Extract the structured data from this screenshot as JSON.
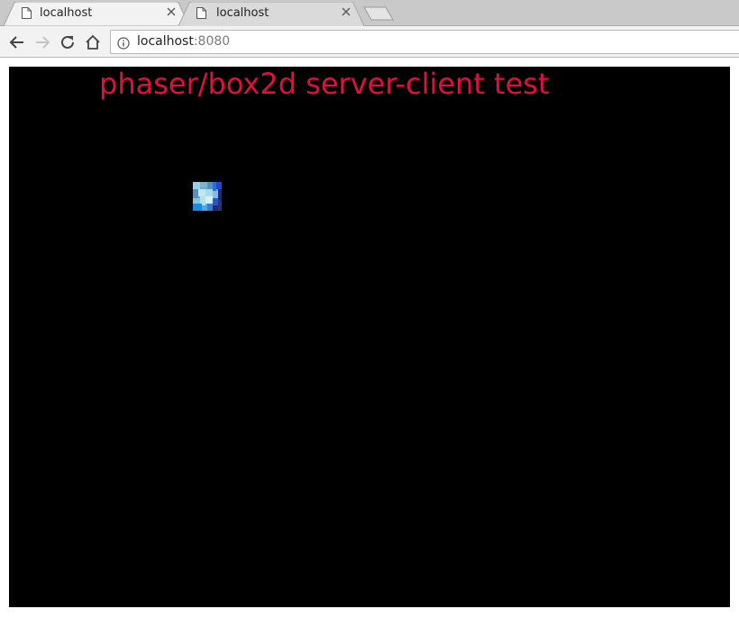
{
  "browser": {
    "tabs": [
      {
        "title": "localhost",
        "active": true
      },
      {
        "title": "localhost",
        "active": false
      }
    ],
    "address_bar": {
      "host": "localhost",
      "port": ":8080"
    }
  },
  "game": {
    "title": "phaser/box2d server-client test",
    "title_color": "#e0103c",
    "background_color": "#000000",
    "sprite": {
      "icon": "box-sprite",
      "colors": [
        "#9ad0e0",
        "#5a90b8",
        "#2a70d0",
        "#c0e8f0",
        "#1a2a80"
      ]
    }
  }
}
